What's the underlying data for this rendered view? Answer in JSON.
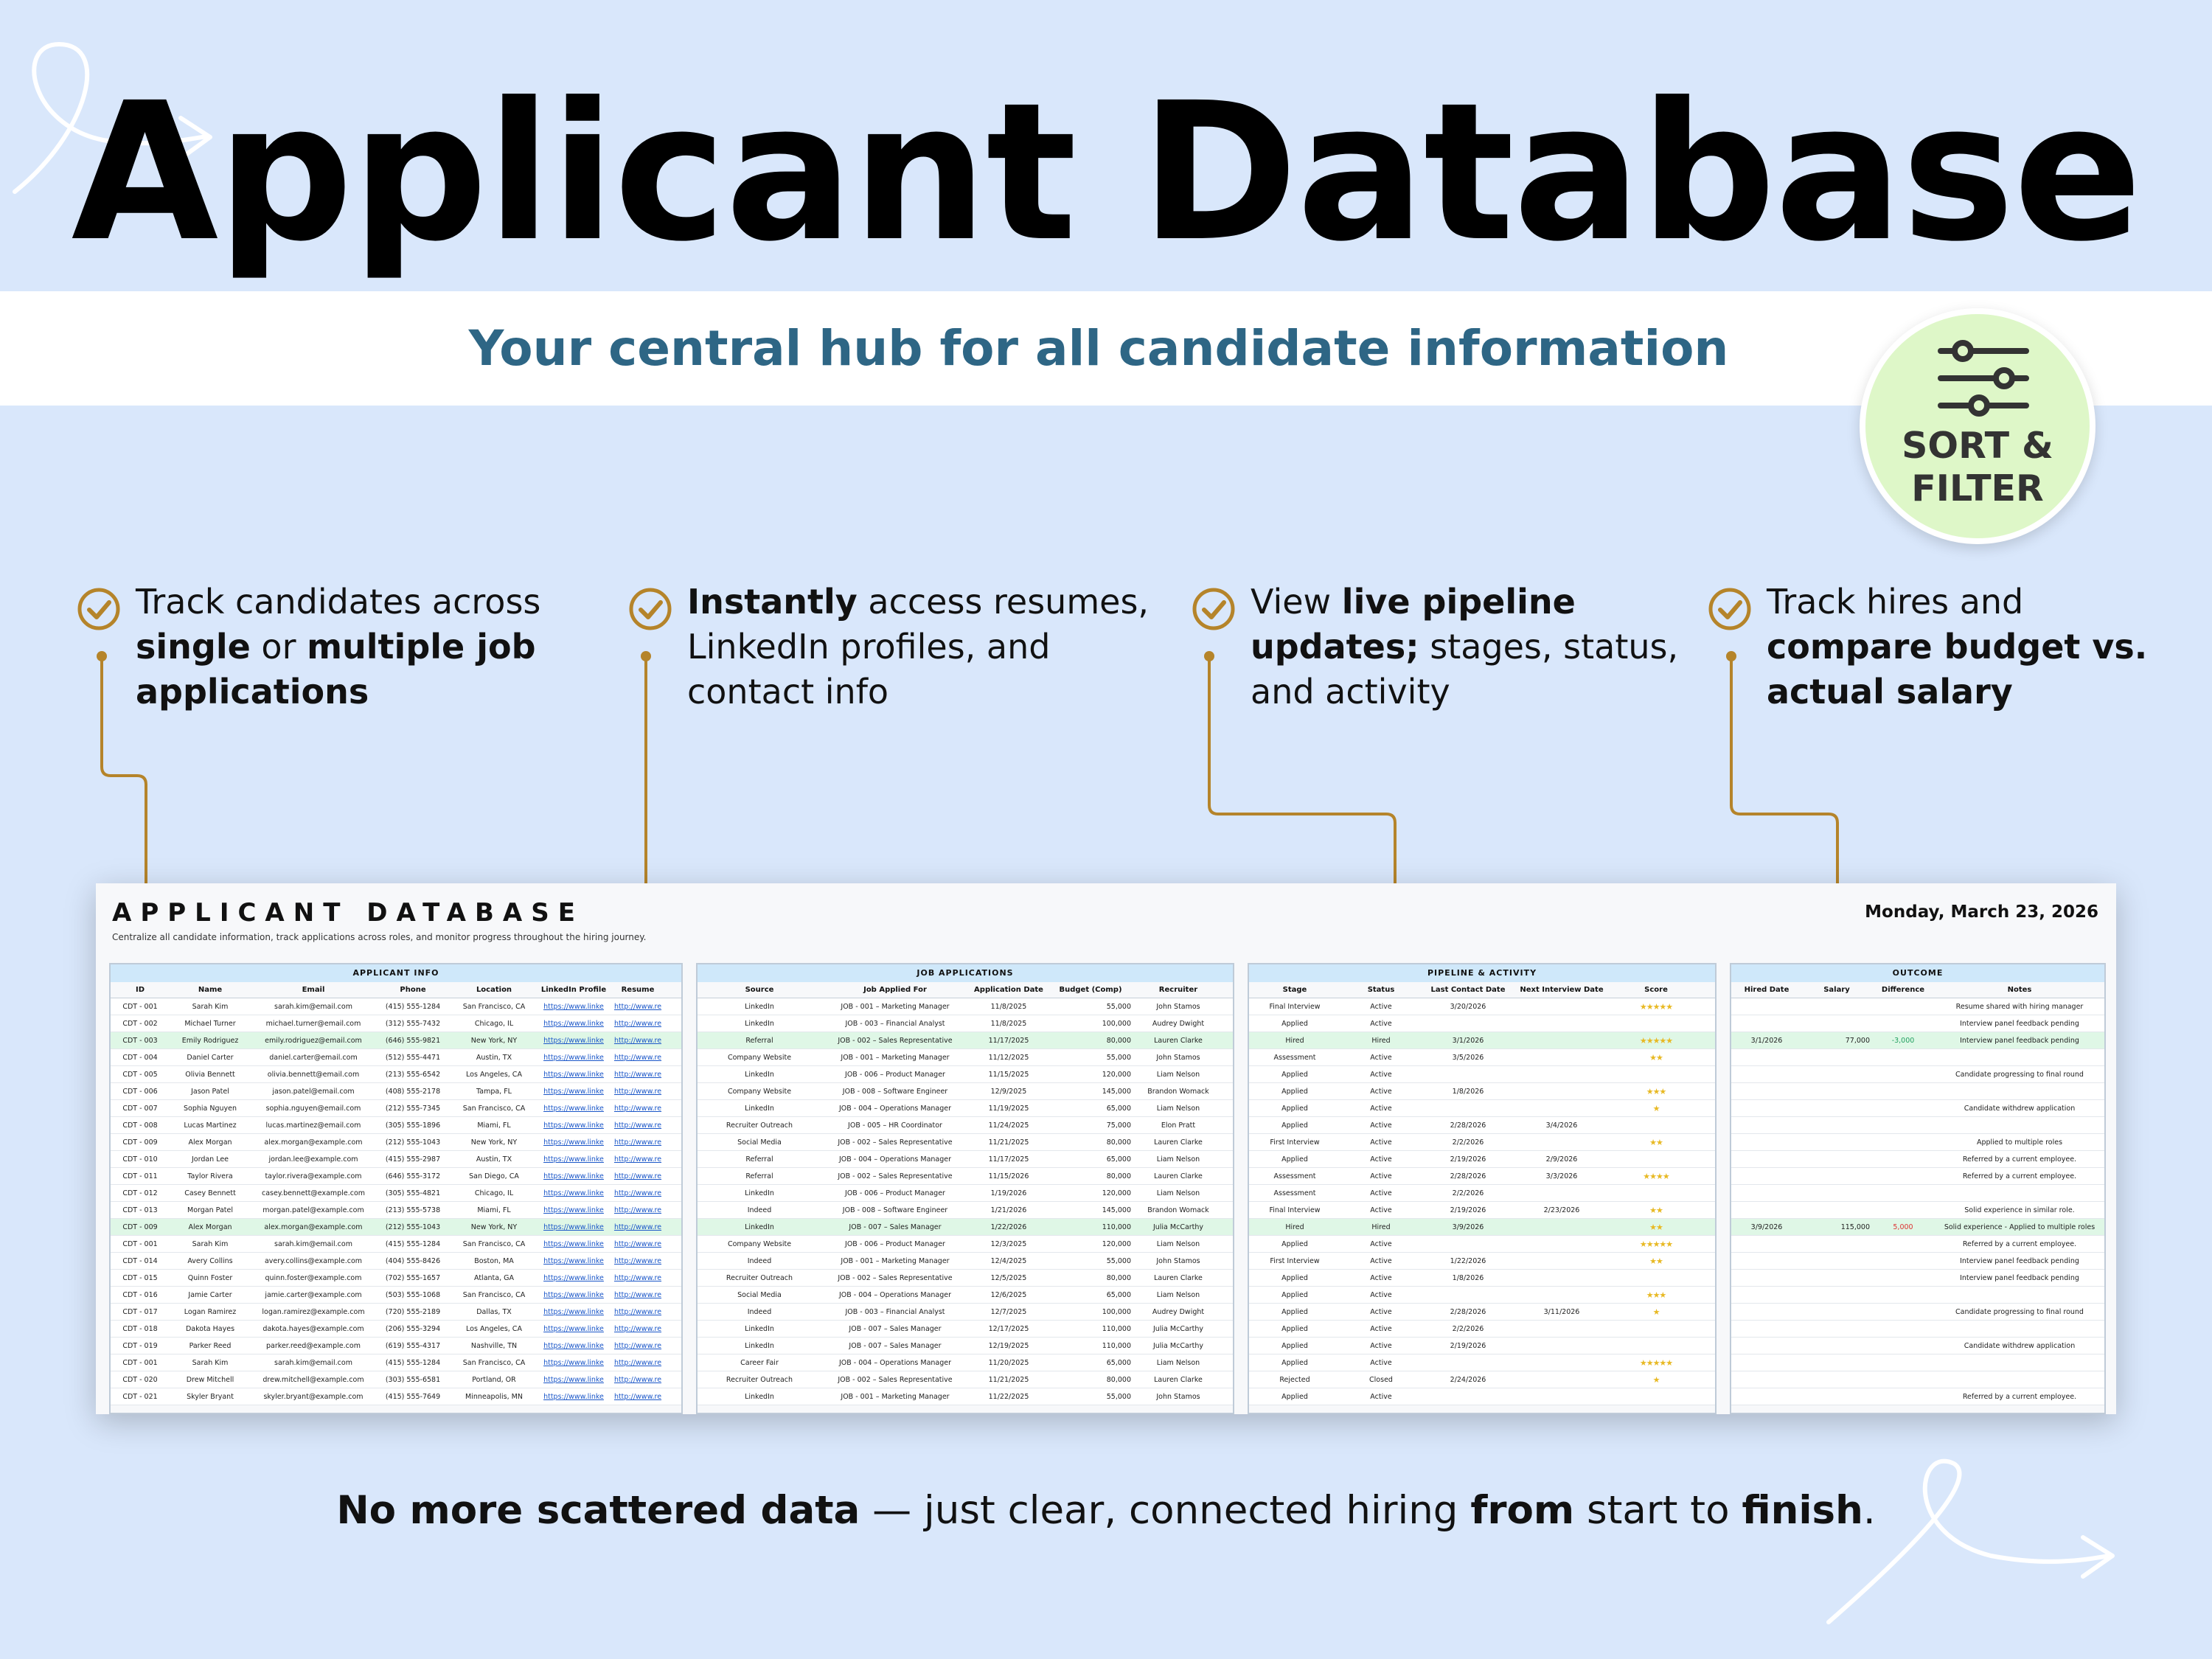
{
  "title": "Applicant Database",
  "subtitle": "Your central hub for all candidate information",
  "badge": {
    "label": "SORT &\nFILTER",
    "icon": "sliders-icon"
  },
  "features": [
    {
      "parts": [
        [
          "Track candidates across ",
          false
        ],
        [
          "single",
          true
        ],
        [
          " or ",
          false
        ],
        [
          "multiple job applications",
          true
        ]
      ]
    },
    {
      "parts": [
        [
          "Instantly",
          true
        ],
        [
          " access resumes, LinkedIn profiles, and contact info",
          false
        ]
      ]
    },
    {
      "parts": [
        [
          "View ",
          false
        ],
        [
          "live pipeline updates;",
          true
        ],
        [
          " stages, status, and activity",
          false
        ]
      ]
    },
    {
      "parts": [
        [
          "Track hires and ",
          false
        ],
        [
          "compare budget vs. actual salary",
          true
        ]
      ]
    }
  ],
  "tagline": {
    "parts": [
      [
        "No more scattered data",
        true
      ],
      [
        " — just clear, connected hiring ",
        false
      ],
      [
        "from",
        true
      ],
      [
        " start to ",
        false
      ],
      [
        "finish",
        true
      ],
      [
        ".",
        false
      ]
    ]
  },
  "colors": {
    "background": "#d9e7fb",
    "subtitle": "#2e6685",
    "badge": "#def7c8",
    "connector": "#b5842a",
    "section_header": "#cfe8fa",
    "hired_row": "#dff7e6",
    "link": "#1a56c8"
  },
  "sheet": {
    "title": "APPLICANT DATABASE",
    "description": "Centralize all candidate information, track applications across roles, and monitor progress throughout the hiring journey.",
    "date": "Monday, March 23, 2026",
    "sections": [
      {
        "title": "APPLICANT INFO",
        "columns": [
          "ID",
          "Name",
          "Email",
          "Phone",
          "Location",
          "LinkedIn Profile",
          "Resume"
        ]
      },
      {
        "title": "JOB APPLICATIONS",
        "columns": [
          "Source",
          "Job Applied For",
          "Application Date",
          "Budget (Comp)",
          "Recruiter"
        ]
      },
      {
        "title": "PIPELINE & ACTIVITY",
        "columns": [
          "Stage",
          "Status",
          "Last Contact Date",
          "Next Interview Date",
          "Score"
        ]
      },
      {
        "title": "OUTCOME",
        "columns": [
          "Hired Date",
          "Salary",
          "Difference",
          "Notes"
        ]
      }
    ],
    "rows": [
      {
        "id": "CDT - 001",
        "name": "Sarah Kim",
        "email": "sarah.kim@email.com",
        "phone": "(415) 555-1284",
        "loc": "San Francisco, CA",
        "li": "https://www.linke",
        "res": "http://www.re",
        "src": "LinkedIn",
        "job": "JOB - 001 – Marketing Manager",
        "date": "11/8/2025",
        "budget": "55,000",
        "rec": "John Stamos",
        "stage": "Final Interview",
        "status": "Active",
        "last": "3/20/2026",
        "next": "",
        "score": "★★★★★",
        "hired": "",
        "salary": "",
        "diff": "",
        "notes": "Resume shared with hiring manager"
      },
      {
        "id": "CDT - 002",
        "name": "Michael Turner",
        "email": "michael.turner@email.com",
        "phone": "(312) 555-7432",
        "loc": "Chicago, IL",
        "li": "https://www.linke",
        "res": "http://www.re",
        "src": "LinkedIn",
        "job": "JOB - 003 – Financial Analyst",
        "date": "11/8/2025",
        "budget": "100,000",
        "rec": "Audrey Dwight",
        "stage": "Applied",
        "status": "Active",
        "last": "",
        "next": "",
        "score": "",
        "hired": "",
        "salary": "",
        "diff": "",
        "notes": "Interview panel feedback pending"
      },
      {
        "id": "CDT - 003",
        "name": "Emily Rodriguez",
        "email": "emily.rodriguez@email.com",
        "phone": "(646) 555-9821",
        "loc": "New York, NY",
        "li": "https://www.linke",
        "res": "http://www.re",
        "src": "Referral",
        "job": "JOB - 002 – Sales Representative",
        "date": "11/17/2025",
        "budget": "80,000",
        "rec": "Lauren Clarke",
        "stage": "Hired",
        "status": "Hired",
        "last": "3/1/2026",
        "next": "",
        "score": "★★★★★",
        "hired": "3/1/2026",
        "salary": "77,000",
        "diff": "-3,000",
        "notes": "Interview panel feedback pending",
        "g": true
      },
      {
        "id": "CDT - 004",
        "name": "Daniel Carter",
        "email": "daniel.carter@email.com",
        "phone": "(512) 555-4471",
        "loc": "Austin, TX",
        "li": "https://www.linke",
        "res": "http://www.re",
        "src": "Company Website",
        "job": "JOB - 001 – Marketing Manager",
        "date": "11/12/2025",
        "budget": "55,000",
        "rec": "John Stamos",
        "stage": "Assessment",
        "status": "Active",
        "last": "3/5/2026",
        "next": "",
        "score": "★★",
        "hired": "",
        "salary": "",
        "diff": "",
        "notes": ""
      },
      {
        "id": "CDT - 005",
        "name": "Olivia Bennett",
        "email": "olivia.bennett@email.com",
        "phone": "(213) 555-6542",
        "loc": "Los Angeles, CA",
        "li": "https://www.linke",
        "res": "http://www.re",
        "src": "LinkedIn",
        "job": "JOB - 006 – Product Manager",
        "date": "11/15/2025",
        "budget": "120,000",
        "rec": "Liam Nelson",
        "stage": "Applied",
        "status": "Active",
        "last": "",
        "next": "",
        "score": "",
        "hired": "",
        "salary": "",
        "diff": "",
        "notes": "Candidate progressing to final round"
      },
      {
        "id": "CDT - 006",
        "name": "Jason Patel",
        "email": "jason.patel@email.com",
        "phone": "(408) 555-2178",
        "loc": "Tampa, FL",
        "li": "https://www.linke",
        "res": "http://www.re",
        "src": "Company Website",
        "job": "JOB - 008 – Software Engineer",
        "date": "12/9/2025",
        "budget": "145,000",
        "rec": "Brandon Womack",
        "stage": "Applied",
        "status": "Active",
        "last": "1/8/2026",
        "next": "",
        "score": "★★★",
        "hired": "",
        "salary": "",
        "diff": "",
        "notes": ""
      },
      {
        "id": "CDT - 007",
        "name": "Sophia Nguyen",
        "email": "sophia.nguyen@email.com",
        "phone": "(212) 555-7345",
        "loc": "San Francisco, CA",
        "li": "https://www.linke",
        "res": "http://www.re",
        "src": "LinkedIn",
        "job": "JOB - 004 – Operations Manager",
        "date": "11/19/2025",
        "budget": "65,000",
        "rec": "Liam Nelson",
        "stage": "Applied",
        "status": "Active",
        "last": "",
        "next": "",
        "score": "★",
        "hired": "",
        "salary": "",
        "diff": "",
        "notes": "Candidate withdrew application"
      },
      {
        "id": "CDT - 008",
        "name": "Lucas Martinez",
        "email": "lucas.martinez@email.com",
        "phone": "(305) 555-1896",
        "loc": "Miami, FL",
        "li": "https://www.linke",
        "res": "http://www.re",
        "src": "Recruiter Outreach",
        "job": "JOB - 005 – HR Coordinator",
        "date": "11/24/2025",
        "budget": "75,000",
        "rec": "Elon Pratt",
        "stage": "Applied",
        "status": "Active",
        "last": "2/28/2026",
        "next": "3/4/2026",
        "score": "",
        "hired": "",
        "salary": "",
        "diff": "",
        "notes": ""
      },
      {
        "id": "CDT - 009",
        "name": "Alex Morgan",
        "email": "alex.morgan@example.com",
        "phone": "(212) 555-1043",
        "loc": "New York, NY",
        "li": "https://www.linke",
        "res": "http://www.re",
        "src": "Social Media",
        "job": "JOB - 002 – Sales Representative",
        "date": "11/21/2025",
        "budget": "80,000",
        "rec": "Lauren Clarke",
        "stage": "First Interview",
        "status": "Active",
        "last": "2/2/2026",
        "next": "",
        "score": "★★",
        "hired": "",
        "salary": "",
        "diff": "",
        "notes": "Applied to multiple roles"
      },
      {
        "id": "CDT - 010",
        "name": "Jordan Lee",
        "email": "jordan.lee@example.com",
        "phone": "(415) 555-2987",
        "loc": "Austin, TX",
        "li": "https://www.linke",
        "res": "http://www.re",
        "src": "Referral",
        "job": "JOB - 004 – Operations Manager",
        "date": "11/17/2025",
        "budget": "65,000",
        "rec": "Liam Nelson",
        "stage": "Applied",
        "status": "Active",
        "last": "2/19/2026",
        "next": "2/9/2026",
        "score": "",
        "hired": "",
        "salary": "",
        "diff": "",
        "notes": "Referred by a current employee."
      },
      {
        "id": "CDT - 011",
        "name": "Taylor Rivera",
        "email": "taylor.rivera@example.com",
        "phone": "(646) 555-3172",
        "loc": "San Diego, CA",
        "li": "https://www.linke",
        "res": "http://www.re",
        "src": "Referral",
        "job": "JOB - 002 – Sales Representative",
        "date": "11/15/2026",
        "budget": "80,000",
        "rec": "Lauren Clarke",
        "stage": "Assessment",
        "status": "Active",
        "last": "2/28/2026",
        "next": "3/3/2026",
        "score": "★★★★",
        "hired": "",
        "salary": "",
        "diff": "",
        "notes": "Referred by a current employee."
      },
      {
        "id": "CDT - 012",
        "name": "Casey Bennett",
        "email": "casey.bennett@example.com",
        "phone": "(305) 555-4821",
        "loc": "Chicago, IL",
        "li": "https://www.linke",
        "res": "http://www.re",
        "src": "LinkedIn",
        "job": "JOB - 006 – Product Manager",
        "date": "1/19/2026",
        "budget": "120,000",
        "rec": "Liam Nelson",
        "stage": "Assessment",
        "status": "Active",
        "last": "2/2/2026",
        "next": "",
        "score": "",
        "hired": "",
        "salary": "",
        "diff": "",
        "notes": ""
      },
      {
        "id": "CDT - 013",
        "name": "Morgan Patel",
        "email": "morgan.patel@example.com",
        "phone": "(213) 555-5738",
        "loc": "Miami, FL",
        "li": "https://www.linke",
        "res": "http://www.re",
        "src": "Indeed",
        "job": "JOB - 008 – Software Engineer",
        "date": "1/21/2026",
        "budget": "145,000",
        "rec": "Brandon Womack",
        "stage": "Final Interview",
        "status": "Active",
        "last": "2/19/2026",
        "next": "2/23/2026",
        "score": "★★",
        "hired": "",
        "salary": "",
        "diff": "",
        "notes": "Solid experience in similar role."
      },
      {
        "id": "CDT - 009",
        "name": "Alex Morgan",
        "email": "alex.morgan@example.com",
        "phone": "(212) 555-1043",
        "loc": "New York, NY",
        "li": "https://www.linke",
        "res": "http://www.re",
        "src": "LinkedIn",
        "job": "JOB - 007 – Sales Manager",
        "date": "1/22/2026",
        "budget": "110,000",
        "rec": "Julia McCarthy",
        "stage": "Hired",
        "status": "Hired",
        "last": "3/9/2026",
        "next": "",
        "score": "★★",
        "hired": "3/9/2026",
        "salary": "115,000",
        "diff": "5,000",
        "notes": "Solid experience - Applied to multiple roles",
        "g": true
      },
      {
        "id": "CDT - 001",
        "name": "Sarah Kim",
        "email": "sarah.kim@email.com",
        "phone": "(415) 555-1284",
        "loc": "San Francisco, CA",
        "li": "https://www.linke",
        "res": "http://www.re",
        "src": "Company Website",
        "job": "JOB - 006 – Product Manager",
        "date": "12/3/2025",
        "budget": "120,000",
        "rec": "Liam Nelson",
        "stage": "Applied",
        "status": "Active",
        "last": "",
        "next": "",
        "score": "★★★★★",
        "hired": "",
        "salary": "",
        "diff": "",
        "notes": "Referred by a current employee."
      },
      {
        "id": "CDT - 014",
        "name": "Avery Collins",
        "email": "avery.collins@example.com",
        "phone": "(404) 555-8426",
        "loc": "Boston, MA",
        "li": "https://www.linke",
        "res": "http://www.re",
        "src": "Indeed",
        "job": "JOB - 001 – Marketing Manager",
        "date": "12/4/2025",
        "budget": "55,000",
        "rec": "John Stamos",
        "stage": "First Interview",
        "status": "Active",
        "last": "1/22/2026",
        "next": "",
        "score": "★★",
        "hired": "",
        "salary": "",
        "diff": "",
        "notes": "Interview panel feedback pending"
      },
      {
        "id": "CDT - 015",
        "name": "Quinn Foster",
        "email": "quinn.foster@example.com",
        "phone": "(702) 555-1657",
        "loc": "Atlanta, GA",
        "li": "https://www.linke",
        "res": "http://www.re",
        "src": "Recruiter Outreach",
        "job": "JOB - 002 – Sales Representative",
        "date": "12/5/2025",
        "budget": "80,000",
        "rec": "Lauren Clarke",
        "stage": "Applied",
        "status": "Active",
        "last": "1/8/2026",
        "next": "",
        "score": "",
        "hired": "",
        "salary": "",
        "diff": "",
        "notes": "Interview panel feedback pending"
      },
      {
        "id": "CDT - 016",
        "name": "Jamie Carter",
        "email": "jamie.carter@example.com",
        "phone": "(503) 555-1068",
        "loc": "San Francisco, CA",
        "li": "https://www.linke",
        "res": "http://www.re",
        "src": "Social Media",
        "job": "JOB - 004 – Operations Manager",
        "date": "12/6/2025",
        "budget": "65,000",
        "rec": "Liam Nelson",
        "stage": "Applied",
        "status": "Active",
        "last": "",
        "next": "",
        "score": "★★★",
        "hired": "",
        "salary": "",
        "diff": "",
        "notes": ""
      },
      {
        "id": "CDT - 017",
        "name": "Logan Ramirez",
        "email": "logan.ramirez@example.com",
        "phone": "(720) 555-2189",
        "loc": "Dallas, TX",
        "li": "https://www.linke",
        "res": "http://www.re",
        "src": "Indeed",
        "job": "JOB - 003 – Financial Analyst",
        "date": "12/7/2025",
        "budget": "100,000",
        "rec": "Audrey Dwight",
        "stage": "Applied",
        "status": "Active",
        "last": "2/28/2026",
        "next": "3/11/2026",
        "score": "★",
        "hired": "",
        "salary": "",
        "diff": "",
        "notes": "Candidate progressing to final round"
      },
      {
        "id": "CDT - 018",
        "name": "Dakota Hayes",
        "email": "dakota.hayes@example.com",
        "phone": "(206) 555-3294",
        "loc": "Los Angeles, CA",
        "li": "https://www.linke",
        "res": "http://www.re",
        "src": "LinkedIn",
        "job": "JOB - 007 – Sales Manager",
        "date": "12/17/2025",
        "budget": "110,000",
        "rec": "Julia McCarthy",
        "stage": "Applied",
        "status": "Active",
        "last": "2/2/2026",
        "next": "",
        "score": "",
        "hired": "",
        "salary": "",
        "diff": "",
        "notes": ""
      },
      {
        "id": "CDT - 019",
        "name": "Parker Reed",
        "email": "parker.reed@example.com",
        "phone": "(619) 555-4317",
        "loc": "Nashville, TN",
        "li": "https://www.linke",
        "res": "http://www.re",
        "src": "LinkedIn",
        "job": "JOB - 007 – Sales Manager",
        "date": "12/19/2025",
        "budget": "110,000",
        "rec": "Julia McCarthy",
        "stage": "Applied",
        "status": "Active",
        "last": "2/19/2026",
        "next": "",
        "score": "",
        "hired": "",
        "salary": "",
        "diff": "",
        "notes": "Candidate withdrew application"
      },
      {
        "id": "CDT - 001",
        "name": "Sarah Kim",
        "email": "sarah.kim@email.com",
        "phone": "(415) 555-1284",
        "loc": "San Francisco, CA",
        "li": "https://www.linke",
        "res": "http://www.re",
        "src": "Career Fair",
        "job": "JOB - 004 – Operations Manager",
        "date": "11/20/2025",
        "budget": "65,000",
        "rec": "Liam Nelson",
        "stage": "Applied",
        "status": "Active",
        "last": "",
        "next": "",
        "score": "★★★★★",
        "hired": "",
        "salary": "",
        "diff": "",
        "notes": ""
      },
      {
        "id": "CDT - 020",
        "name": "Drew Mitchell",
        "email": "drew.mitchell@example.com",
        "phone": "(303) 555-6581",
        "loc": "Portland, OR",
        "li": "https://www.linke",
        "res": "http://www.re",
        "src": "Recruiter Outreach",
        "job": "JOB - 002 – Sales Representative",
        "date": "11/21/2025",
        "budget": "80,000",
        "rec": "Lauren Clarke",
        "stage": "Rejected",
        "status": "Closed",
        "last": "2/24/2026",
        "next": "",
        "score": "★",
        "hired": "",
        "salary": "",
        "diff": "",
        "notes": ""
      },
      {
        "id": "CDT - 021",
        "name": "Skyler Bryant",
        "email": "skyler.bryant@example.com",
        "phone": "(415) 555-7649",
        "loc": "Minneapolis, MN",
        "li": "https://www.linke",
        "res": "http://www.re",
        "src": "LinkedIn",
        "job": "JOB - 001 – Marketing Manager",
        "date": "11/22/2025",
        "budget": "55,000",
        "rec": "John Stamos",
        "stage": "Applied",
        "status": "Active",
        "last": "",
        "next": "",
        "score": "",
        "hired": "",
        "salary": "",
        "diff": "",
        "notes": "Referred by a current employee."
      }
    ]
  }
}
